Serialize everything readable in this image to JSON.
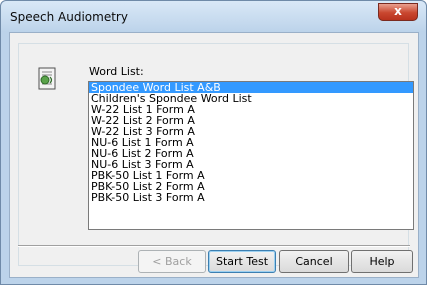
{
  "window": {
    "title": "Speech Audiometry",
    "close_label": "x"
  },
  "word_list": {
    "label": "Word List:",
    "items": [
      {
        "label": "Spondee Word List A&B",
        "selected": true
      },
      {
        "label": "Children's Spondee Word List"
      },
      {
        "label": "W-22 List 1 Form A"
      },
      {
        "label": "W-22 List 2 Form A"
      },
      {
        "label": "W-22 List 3 Form A"
      },
      {
        "label": "NU-6 List 1 Form A"
      },
      {
        "label": "NU-6 List 2 Form A"
      },
      {
        "label": "NU-6 List 3 Form A"
      },
      {
        "label": "PBK-50 List 1 Form A"
      },
      {
        "label": "PBK-50 List 2 Form A"
      },
      {
        "label": "PBK-50 List 3 Form A"
      }
    ]
  },
  "buttons": {
    "back": "< Back",
    "start": "Start Test",
    "cancel": "Cancel",
    "help": "Help"
  },
  "icons": {
    "dialog_icon": "document-speaker-icon"
  }
}
